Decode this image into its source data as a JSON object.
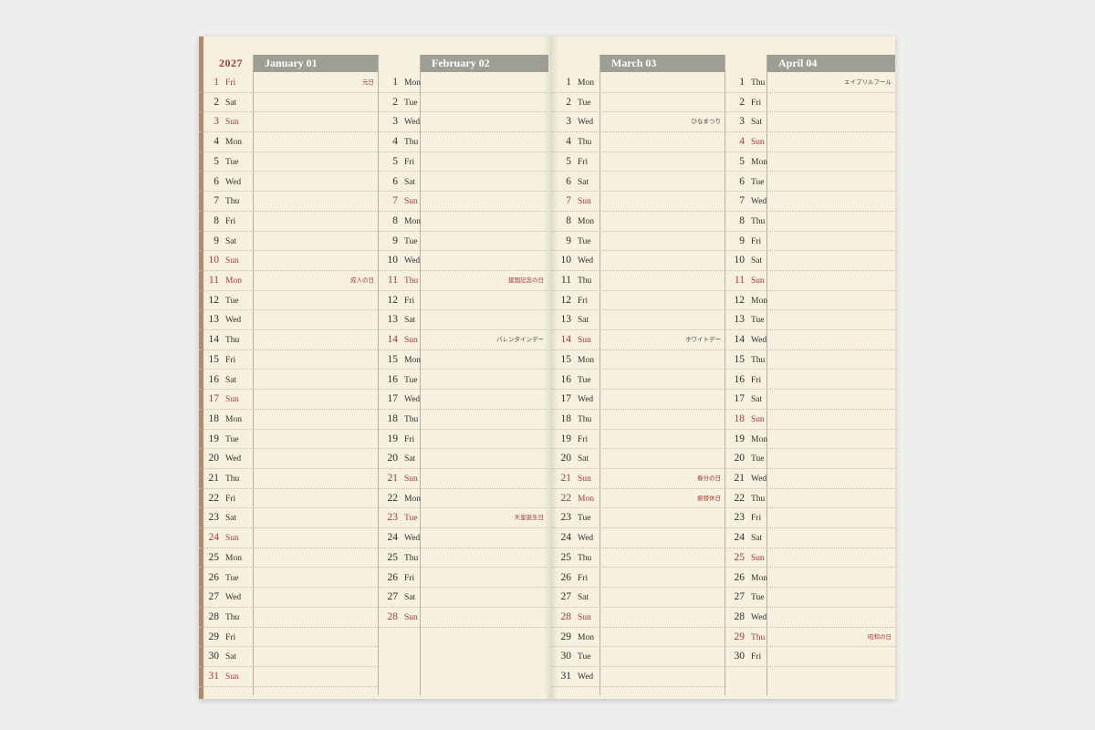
{
  "year": "2027",
  "months": [
    {
      "header": "January 01",
      "days": [
        {
          "n": "1",
          "w": "Fri",
          "red": true,
          "h": "元日"
        },
        {
          "n": "2",
          "w": "Sat"
        },
        {
          "n": "3",
          "w": "Sun",
          "red": true
        },
        {
          "n": "4",
          "w": "Mon"
        },
        {
          "n": "5",
          "w": "Tue"
        },
        {
          "n": "6",
          "w": "Wed"
        },
        {
          "n": "7",
          "w": "Thu"
        },
        {
          "n": "8",
          "w": "Fri"
        },
        {
          "n": "9",
          "w": "Sat"
        },
        {
          "n": "10",
          "w": "Sun",
          "red": true
        },
        {
          "n": "11",
          "w": "Mon",
          "red": true,
          "h": "成人の日"
        },
        {
          "n": "12",
          "w": "Tue"
        },
        {
          "n": "13",
          "w": "Wed"
        },
        {
          "n": "14",
          "w": "Thu"
        },
        {
          "n": "15",
          "w": "Fri"
        },
        {
          "n": "16",
          "w": "Sat"
        },
        {
          "n": "17",
          "w": "Sun",
          "red": true
        },
        {
          "n": "18",
          "w": "Mon"
        },
        {
          "n": "19",
          "w": "Tue"
        },
        {
          "n": "20",
          "w": "Wed"
        },
        {
          "n": "21",
          "w": "Thu"
        },
        {
          "n": "22",
          "w": "Fri"
        },
        {
          "n": "23",
          "w": "Sat"
        },
        {
          "n": "24",
          "w": "Sun",
          "red": true
        },
        {
          "n": "25",
          "w": "Mon"
        },
        {
          "n": "26",
          "w": "Tue"
        },
        {
          "n": "27",
          "w": "Wed"
        },
        {
          "n": "28",
          "w": "Thu"
        },
        {
          "n": "29",
          "w": "Fri"
        },
        {
          "n": "30",
          "w": "Sat"
        },
        {
          "n": "31",
          "w": "Sun",
          "red": true
        }
      ]
    },
    {
      "header": "February 02",
      "days": [
        {
          "n": "1",
          "w": "Mon"
        },
        {
          "n": "2",
          "w": "Tue"
        },
        {
          "n": "3",
          "w": "Wed"
        },
        {
          "n": "4",
          "w": "Thu"
        },
        {
          "n": "5",
          "w": "Fri"
        },
        {
          "n": "6",
          "w": "Sat"
        },
        {
          "n": "7",
          "w": "Sun",
          "red": true
        },
        {
          "n": "8",
          "w": "Mon"
        },
        {
          "n": "9",
          "w": "Tue"
        },
        {
          "n": "10",
          "w": "Wed"
        },
        {
          "n": "11",
          "w": "Thu",
          "red": true,
          "h": "建国記念の日"
        },
        {
          "n": "12",
          "w": "Fri"
        },
        {
          "n": "13",
          "w": "Sat"
        },
        {
          "n": "14",
          "w": "Sun",
          "red": true,
          "h": "バレンタインデー",
          "plain": true
        },
        {
          "n": "15",
          "w": "Mon"
        },
        {
          "n": "16",
          "w": "Tue"
        },
        {
          "n": "17",
          "w": "Wed"
        },
        {
          "n": "18",
          "w": "Thu"
        },
        {
          "n": "19",
          "w": "Fri"
        },
        {
          "n": "20",
          "w": "Sat"
        },
        {
          "n": "21",
          "w": "Sun",
          "red": true
        },
        {
          "n": "22",
          "w": "Mon"
        },
        {
          "n": "23",
          "w": "Tue",
          "red": true,
          "h": "天皇誕生日"
        },
        {
          "n": "24",
          "w": "Wed"
        },
        {
          "n": "25",
          "w": "Thu"
        },
        {
          "n": "26",
          "w": "Fri"
        },
        {
          "n": "27",
          "w": "Sat"
        },
        {
          "n": "28",
          "w": "Sun",
          "red": true
        }
      ]
    },
    {
      "header": "March 03",
      "days": [
        {
          "n": "1",
          "w": "Mon"
        },
        {
          "n": "2",
          "w": "Tue"
        },
        {
          "n": "3",
          "w": "Wed",
          "h": "ひなまつり",
          "plain": true
        },
        {
          "n": "4",
          "w": "Thu"
        },
        {
          "n": "5",
          "w": "Fri"
        },
        {
          "n": "6",
          "w": "Sat"
        },
        {
          "n": "7",
          "w": "Sun",
          "red": true
        },
        {
          "n": "8",
          "w": "Mon"
        },
        {
          "n": "9",
          "w": "Tue"
        },
        {
          "n": "10",
          "w": "Wed"
        },
        {
          "n": "11",
          "w": "Thu"
        },
        {
          "n": "12",
          "w": "Fri"
        },
        {
          "n": "13",
          "w": "Sat"
        },
        {
          "n": "14",
          "w": "Sun",
          "red": true,
          "h": "ホワイトデー",
          "plain": true
        },
        {
          "n": "15",
          "w": "Mon"
        },
        {
          "n": "16",
          "w": "Tue"
        },
        {
          "n": "17",
          "w": "Wed"
        },
        {
          "n": "18",
          "w": "Thu"
        },
        {
          "n": "19",
          "w": "Fri"
        },
        {
          "n": "20",
          "w": "Sat"
        },
        {
          "n": "21",
          "w": "Sun",
          "red": true,
          "h": "春分の日"
        },
        {
          "n": "22",
          "w": "Mon",
          "red": true,
          "h": "振替休日"
        },
        {
          "n": "23",
          "w": "Tue"
        },
        {
          "n": "24",
          "w": "Wed"
        },
        {
          "n": "25",
          "w": "Thu"
        },
        {
          "n": "26",
          "w": "Fri"
        },
        {
          "n": "27",
          "w": "Sat"
        },
        {
          "n": "28",
          "w": "Sun",
          "red": true
        },
        {
          "n": "29",
          "w": "Mon"
        },
        {
          "n": "30",
          "w": "Tue"
        },
        {
          "n": "31",
          "w": "Wed"
        }
      ]
    },
    {
      "header": "April 04",
      "days": [
        {
          "n": "1",
          "w": "Thu",
          "h": "エイプリルフール",
          "plain": true
        },
        {
          "n": "2",
          "w": "Fri"
        },
        {
          "n": "3",
          "w": "Sat"
        },
        {
          "n": "4",
          "w": "Sun",
          "red": true
        },
        {
          "n": "5",
          "w": "Mon"
        },
        {
          "n": "6",
          "w": "Tue"
        },
        {
          "n": "7",
          "w": "Wed"
        },
        {
          "n": "8",
          "w": "Thu"
        },
        {
          "n": "9",
          "w": "Fri"
        },
        {
          "n": "10",
          "w": "Sat"
        },
        {
          "n": "11",
          "w": "Sun",
          "red": true
        },
        {
          "n": "12",
          "w": "Mon"
        },
        {
          "n": "13",
          "w": "Tue"
        },
        {
          "n": "14",
          "w": "Wed"
        },
        {
          "n": "15",
          "w": "Thu"
        },
        {
          "n": "16",
          "w": "Fri"
        },
        {
          "n": "17",
          "w": "Sat"
        },
        {
          "n": "18",
          "w": "Sun",
          "red": true
        },
        {
          "n": "19",
          "w": "Mon"
        },
        {
          "n": "20",
          "w": "Tue"
        },
        {
          "n": "21",
          "w": "Wed"
        },
        {
          "n": "22",
          "w": "Thu"
        },
        {
          "n": "23",
          "w": "Fri"
        },
        {
          "n": "24",
          "w": "Sat"
        },
        {
          "n": "25",
          "w": "Sun",
          "red": true
        },
        {
          "n": "26",
          "w": "Mon"
        },
        {
          "n": "27",
          "w": "Tue"
        },
        {
          "n": "28",
          "w": "Wed"
        },
        {
          "n": "29",
          "w": "Thu",
          "red": true,
          "h": "昭和の日"
        },
        {
          "n": "30",
          "w": "Fri"
        }
      ]
    }
  ],
  "colors": {
    "paper": "#f5f1de",
    "header": "#9d9e94",
    "sunday_red": "#a53a3a",
    "background": "#eeeeec"
  }
}
